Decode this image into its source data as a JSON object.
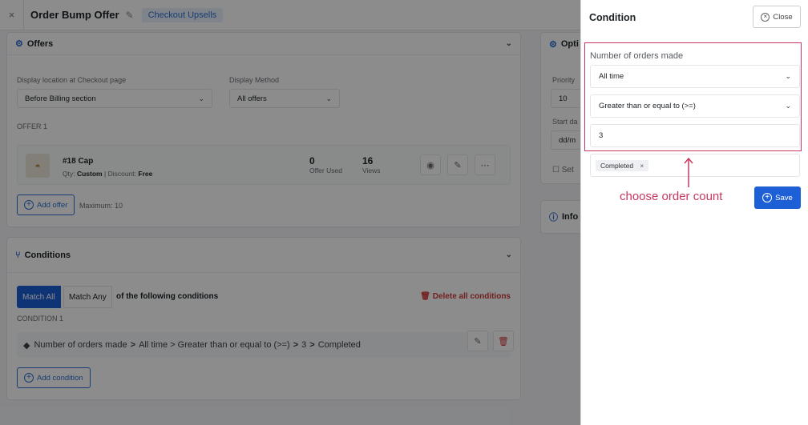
{
  "header": {
    "title": "Order Bump Offer",
    "tag": "Checkout Upsells",
    "close_glyph": "×",
    "edit_glyph": "✎"
  },
  "offers": {
    "title": "Offers",
    "display_location_label": "Display location at Checkout page",
    "display_location_value": "Before Billing section",
    "display_method_label": "Display Method",
    "display_method_value": "All offers",
    "offer_label": "OFFER 1",
    "item": {
      "name": "#18 Cap",
      "qty_label": "Qty:",
      "qty_value": "Custom",
      "sep": "|",
      "discount_label": "Discount:",
      "discount_value": "Free",
      "offer_used_value": "0",
      "offer_used_label": "Offer Used",
      "views_value": "16",
      "views_label": "Views"
    },
    "add_offer_label": "Add offer",
    "maximum_text": "Maximum: 10"
  },
  "conditions": {
    "title": "Conditions",
    "match_all": "Match All",
    "match_any": "Match Any",
    "following_text": "of the following conditions",
    "delete_all": "Delete all conditions",
    "condition_label": "CONDITION 1",
    "row": {
      "name": "Number of orders made",
      "part1": "All time > Greater than or equal to (>=)",
      "part2": "3",
      "part3": "Completed",
      "sep": ">"
    },
    "add_condition_label": "Add condition"
  },
  "options_side": {
    "title": "Opti",
    "priority_label": "Priority",
    "priority_value": "10",
    "start_label": "Start da",
    "start_value": "dd/m",
    "set_label": "Set",
    "info_title": "Info"
  },
  "panel": {
    "title": "Condition",
    "close_label": "Close",
    "field_label": "Number of orders made",
    "period_value": "All time",
    "operator_value": "Greater than or equal to (>=)",
    "count_value": "3",
    "status_chip": "Completed",
    "annotation": "choose order count",
    "save_label": "Save"
  },
  "colors": {
    "accent": "#1d5fd6",
    "annotation": "#c7385f",
    "danger": "#d23a3a"
  }
}
